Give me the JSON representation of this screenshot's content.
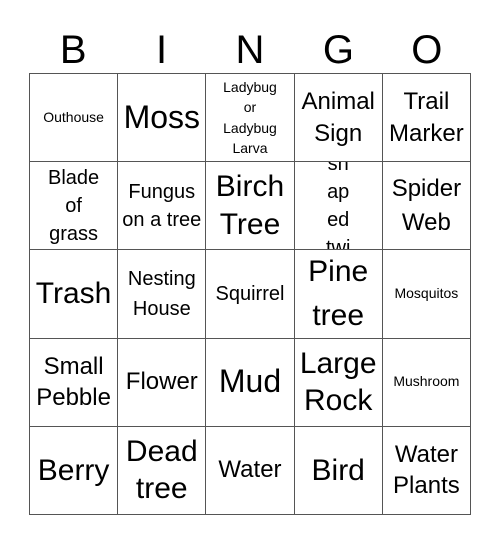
{
  "header": {
    "letters": [
      "B",
      "I",
      "N",
      "G",
      "O"
    ]
  },
  "board": {
    "rows": [
      [
        "Outhouse",
        "Moss",
        "Ladybug or Ladybug Larva",
        "Animal Sign",
        "Trail Marker"
      ],
      [
        "Blade of grass",
        "Fungus on a tree",
        "Birch Tree",
        "Y-shaped twig",
        "Spider Web"
      ],
      [
        "Trash",
        "Nesting House",
        "Squirrel",
        "Pine tree",
        "Mosquitos"
      ],
      [
        "Small Pebble",
        "Flower",
        "Mud",
        "Large Rock",
        "Mushroom"
      ],
      [
        "Berry",
        "Dead tree",
        "Water",
        "Bird",
        "Water Plants"
      ]
    ]
  }
}
